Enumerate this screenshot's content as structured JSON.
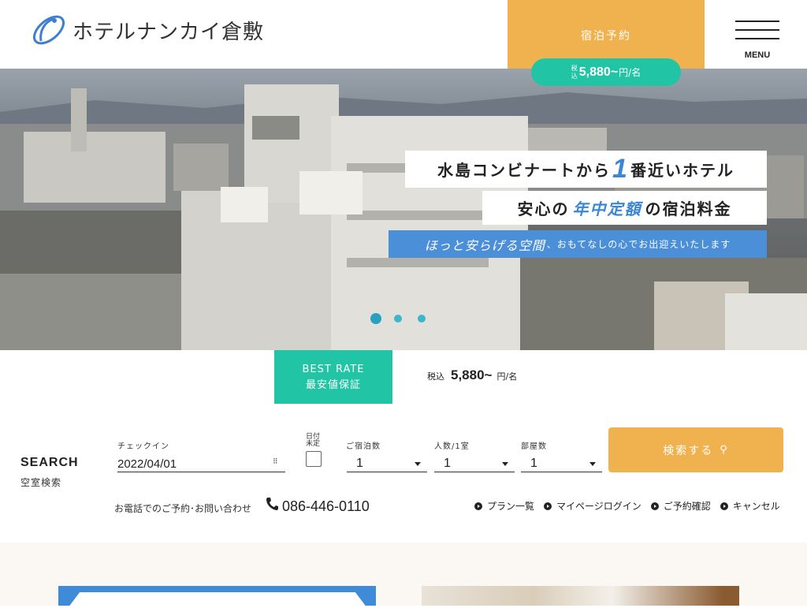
{
  "header": {
    "logo_text": "ホテルナンカイ倉敷",
    "reserve_label": "宿泊予約",
    "price_pill": {
      "tax_label": "税込",
      "price": "5,880~",
      "unit": "円/名"
    },
    "menu_label": "MENU"
  },
  "hero": {
    "line1_pre": "水島コンビナートから",
    "line1_num": "1",
    "line1_post": "番近いホテル",
    "line2_pre": "安心の",
    "line2_accent": "年中定額",
    "line2_post": "の宿泊料金",
    "line3_lead": "ほっと安らげる空間",
    "line3_rest": "、おもてなしの心でお出迎えいたします",
    "slide_count": 3,
    "active_slide": 1
  },
  "best_rate": {
    "title": "BEST RATE",
    "subtitle": "最安値保証",
    "tax_label": "税込",
    "price": "5,880~",
    "unit": "円/名"
  },
  "search": {
    "title": "SEARCH",
    "subtitle": "空室検索",
    "checkin_label": "チェックイン",
    "checkin_value": "2022/04/01",
    "undecided_label": "日付未定",
    "nights_label": "ご宿泊数",
    "nights_value": "1",
    "people_label": "人数/1室",
    "people_value": "1",
    "rooms_label": "部屋数",
    "rooms_value": "1",
    "button_label": "検索する"
  },
  "contact": {
    "lead": "お電話でのご予約･お問い合わせ",
    "phone": "086-446-0110"
  },
  "quick_links": [
    "プラン一覧",
    "マイページログイン",
    "ご予約確認",
    "キャンセル"
  ],
  "colors": {
    "accent_orange": "#f0b24e",
    "accent_teal": "#21c4a5",
    "accent_blue": "#3b86d6"
  }
}
